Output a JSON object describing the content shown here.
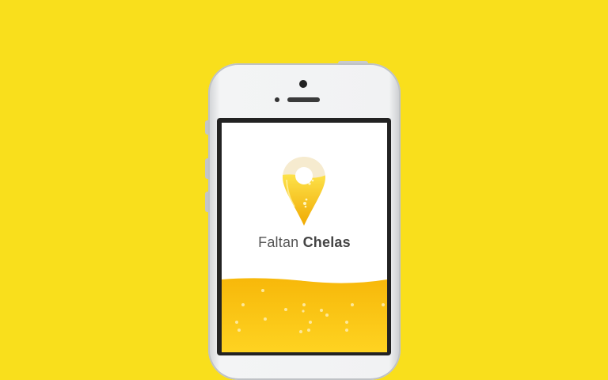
{
  "app": {
    "name_light": "Faltan",
    "name_bold": "Chelas"
  },
  "colors": {
    "background": "#f9df1c",
    "beer": "#fbc30a",
    "foam": "#f6ebcf",
    "screen": "#ffffff"
  },
  "icons": {
    "logo": "beer-location-pin-icon"
  }
}
